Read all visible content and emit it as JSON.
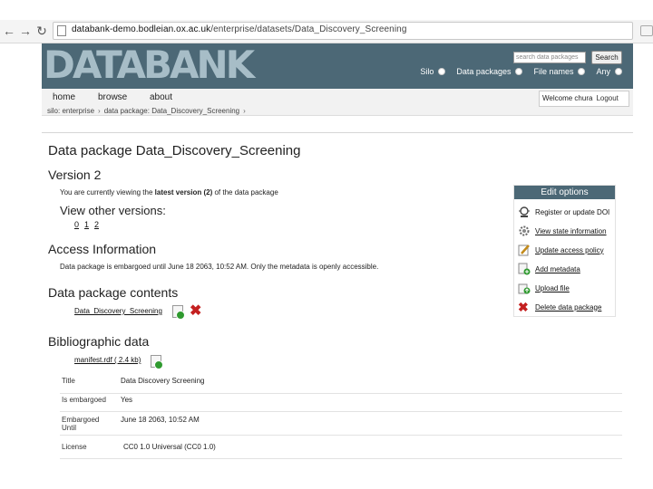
{
  "browser": {
    "url_host": "databank-demo.bodleian.ox.ac.uk",
    "url_path": "/enterprise/datasets/Data_Discovery_Screening"
  },
  "header": {
    "logo": "DATABANK",
    "search_placeholder": "search data packages",
    "search_button": "Search",
    "radio_options": [
      "Silo",
      "Data packages",
      "File names",
      "Any"
    ]
  },
  "nav": {
    "links": [
      "home",
      "browse",
      "about"
    ],
    "breadcrumb": [
      "silo: enterprise",
      "data package: Data_Discovery_Screening"
    ],
    "welcome": "Welcome chura",
    "logout": "Logout"
  },
  "main": {
    "title": "Data package Data_Discovery_Screening",
    "version_heading": "Version 2",
    "version_text_pre": "You are currently viewing the",
    "version_text_bold": "latest version (2)",
    "version_text_post": "of the data package",
    "other_versions_heading": "View other versions:",
    "versions": [
      "0",
      "1",
      "2"
    ],
    "access_heading": "Access Information",
    "access_text": "Data package is embargoed until June 18 2063, 10:52 AM. Only the metadata is openly accessible.",
    "contents_heading": "Data package contents",
    "contents_file": "Data_Discovery_Screening",
    "bib_heading": "Bibliographic data",
    "manifest_file": "manifest.rdf ( 2.4 kb)",
    "bib_rows": [
      {
        "key": "Title",
        "value": "Data Discovery Screening"
      },
      {
        "key": "Is embargoed",
        "value": "Yes"
      },
      {
        "key": "Embargoed Until",
        "value": "June 18 2063, 10:52 AM"
      },
      {
        "key": "License",
        "value": "CC0 1.0 Universal (CC0 1.0)"
      }
    ]
  },
  "edit_panel": {
    "title": "Edit options",
    "items": [
      {
        "label": "Register or update DOI",
        "icon": "doi-icon"
      },
      {
        "label": "View state information",
        "icon": "gear-icon"
      },
      {
        "label": "Update access policy",
        "icon": "pencil-icon"
      },
      {
        "label": "Add metadata",
        "icon": "add-metadata-icon"
      },
      {
        "label": "Upload file",
        "icon": "upload-icon"
      },
      {
        "label": "Delete data package",
        "icon": "delete-icon"
      }
    ]
  },
  "colors": {
    "header_bg": "#4c6876",
    "logo": "#a7bdc7",
    "delete_red": "#c42020",
    "add_green": "#2f9a2f"
  }
}
